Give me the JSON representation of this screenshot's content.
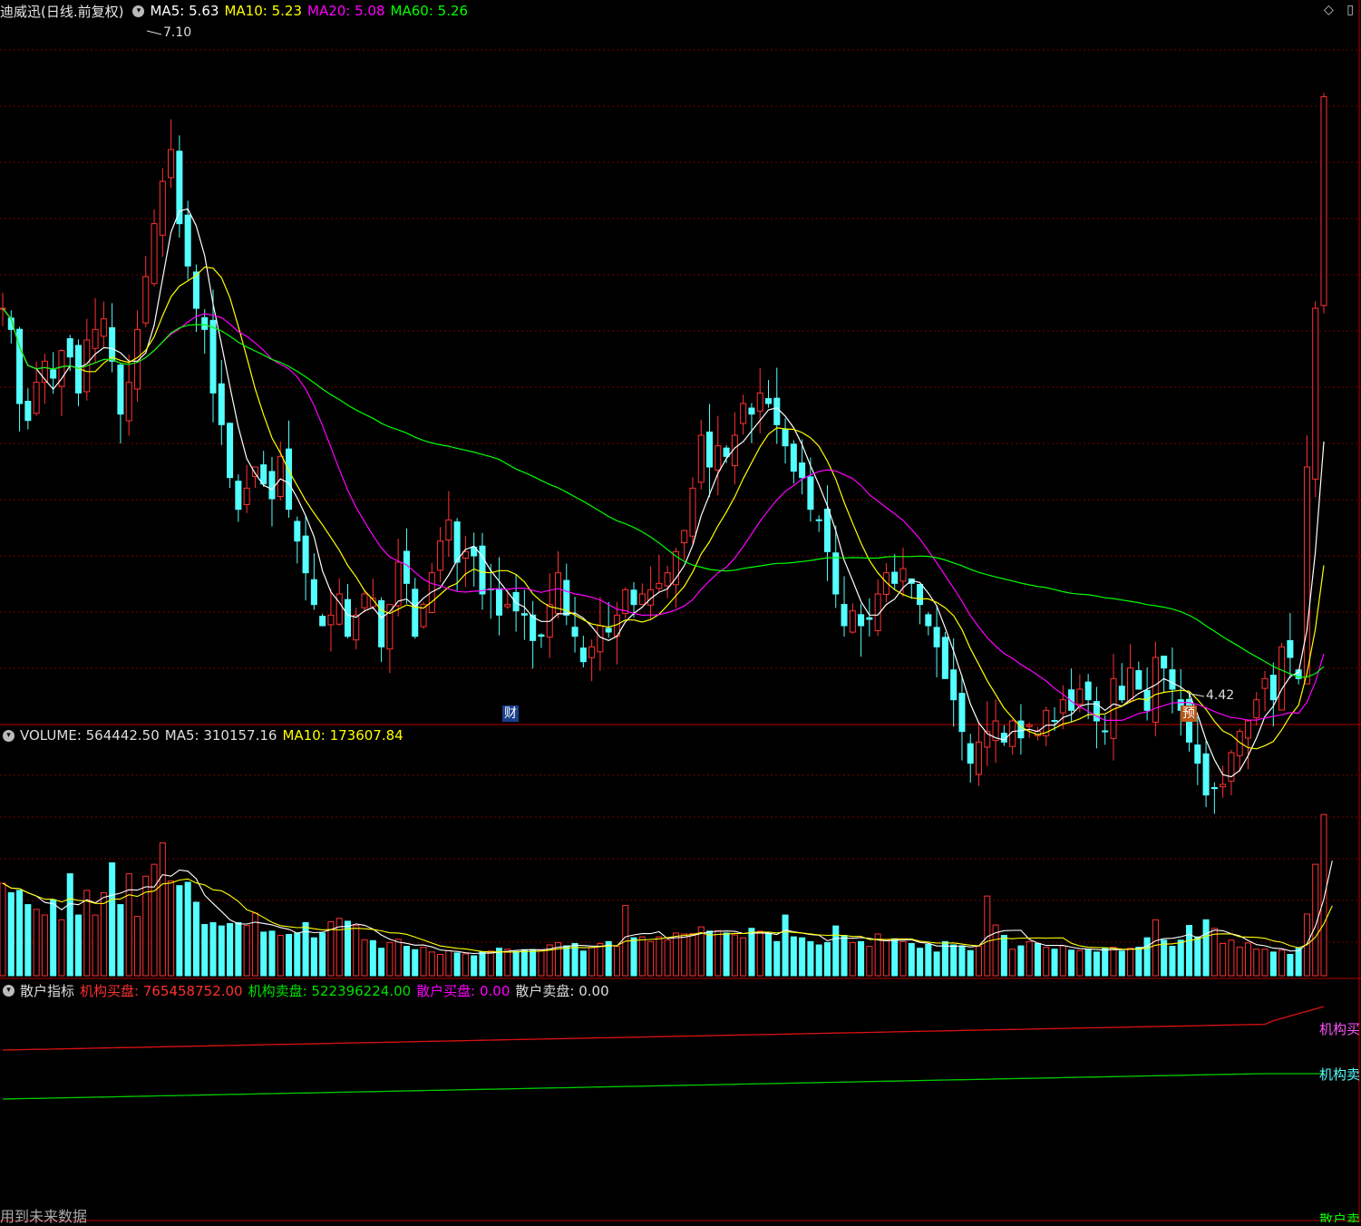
{
  "price_panel": {
    "title": "迪威迅(日线.前复权)",
    "ma": [
      {
        "label": "MA5: ",
        "value": "5.63",
        "color": "#ffffff"
      },
      {
        "label": "MA10: ",
        "value": "5.23",
        "color": "#ffff00"
      },
      {
        "label": "MA20: ",
        "value": "5.08",
        "color": "#ff00ff"
      },
      {
        "label": "MA60: ",
        "value": "5.26",
        "color": "#00ff00"
      }
    ],
    "high_label": "7.10",
    "low_label": "4.42",
    "badge_cai": "财",
    "badge_yu": "预"
  },
  "volume_panel": {
    "name": "VOLUME: ",
    "value": "564442.50",
    "ma5_label": "MA5: ",
    "ma5_value": "310157.16",
    "ma10_label": "MA10: ",
    "ma10_value": "173607.84"
  },
  "indicator_panel": {
    "name": "散户指标",
    "items": [
      {
        "label": "机构买盘: ",
        "value": "765458752.00",
        "color": "#ff3030"
      },
      {
        "label": "机构卖盘: ",
        "value": "522396224.00",
        "color": "#00e000"
      },
      {
        "label": "散户买盘: ",
        "value": "0.00",
        "color": "#ff00ff"
      },
      {
        "label": "散户卖盘: ",
        "value": "0.00",
        "color": "#dddddd"
      }
    ],
    "right_label_1": "机构买",
    "right_label_2": "机构卖",
    "right_label_3": "散户卖"
  },
  "footer_text": "用到未来数据",
  "colors": {
    "up": "#ff3232",
    "down": "#54ffff",
    "grid": "#7a0000",
    "border": "#b00000"
  },
  "chart_data": {
    "type": "candlestick",
    "ylim": [
      4.0,
      7.3
    ],
    "closes": [
      5.95,
      5.85,
      5.5,
      5.42,
      5.6,
      5.7,
      5.62,
      5.75,
      5.72,
      5.55,
      5.8,
      5.85,
      5.9,
      5.7,
      5.45,
      5.6,
      5.85,
      6.1,
      6.35,
      6.55,
      6.7,
      6.35,
      6.15,
      5.95,
      5.85,
      5.55,
      5.4,
      5.15,
      5.0,
      5.1,
      5.2,
      5.12,
      5.05,
      5.25,
      5.0,
      4.85,
      4.7,
      4.55,
      4.45,
      4.5,
      4.6,
      4.4,
      4.5,
      4.6,
      4.58,
      4.35,
      4.55,
      4.75,
      4.65,
      4.4,
      4.55,
      4.7,
      4.85,
      4.95,
      4.75,
      4.8,
      4.78,
      4.6,
      4.62,
      4.5,
      4.55,
      4.52,
      4.5,
      4.38,
      4.4,
      4.55,
      4.7,
      4.5,
      4.4,
      4.28,
      4.35,
      4.45,
      4.42,
      4.5,
      4.62,
      4.55,
      4.6,
      4.62,
      4.65,
      4.7,
      4.8,
      4.9,
      5.1,
      5.35,
      5.2,
      5.3,
      5.25,
      5.35,
      5.5,
      5.45,
      5.55,
      5.5,
      5.4,
      5.3,
      5.18,
      5.15,
      5.0,
      4.95,
      4.8,
      4.6,
      4.45,
      4.52,
      4.45,
      4.48,
      4.6,
      4.7,
      4.65,
      4.72,
      4.65,
      4.55,
      4.45,
      4.35,
      4.2,
      4.1,
      3.95,
      3.8,
      3.9,
      3.95,
      4.0,
      3.9,
      4.0,
      3.92,
      3.98,
      3.95,
      4.05,
      4.0,
      4.1,
      4.05,
      4.15,
      4.1,
      4.0,
      3.95,
      4.2,
      4.1,
      4.25,
      4.15,
      4.05,
      4.3,
      4.25,
      4.15,
      4.05,
      3.9,
      3.8,
      3.65,
      3.68,
      3.7,
      3.85,
      3.95,
      4.0,
      4.1,
      4.2,
      4.1,
      4.35,
      4.3,
      4.2,
      5.2,
      5.95,
      6.95
    ],
    "volumes": [
      195000,
      175000,
      180000,
      150000,
      140000,
      128000,
      160000,
      118000,
      215000,
      128000,
      180000,
      128000,
      175000,
      238000,
      150000,
      215000,
      125000,
      210000,
      235000,
      280000,
      200000,
      190000,
      197000,
      155000,
      108000,
      112000,
      105000,
      110000,
      112000,
      106000,
      132000,
      92000,
      94000,
      85000,
      87000,
      90000,
      112000,
      80000,
      90000,
      114000,
      121000,
      115000,
      106000,
      76000,
      74000,
      58000,
      70000,
      77000,
      62000,
      55000,
      60000,
      50000,
      45000,
      53000,
      48000,
      46000,
      42000,
      50000,
      52000,
      58000,
      56000,
      51000,
      55000,
      55000,
      55000,
      65000,
      70000,
      63000,
      68000,
      52000,
      60000,
      68000,
      72000,
      62000,
      148000,
      80000,
      82000,
      72000,
      82000,
      75000,
      90000,
      88000,
      89000,
      103000,
      94000,
      95000,
      90000,
      86000,
      80000,
      100000,
      94000,
      88000,
      72000,
      128000,
      82000,
      80000,
      72000,
      65000,
      70000,
      105000,
      85000,
      70000,
      72000,
      62000,
      88000,
      75000,
      78000,
      72000,
      68000,
      58000,
      66000,
      50000,
      72000,
      65000,
      63000,
      53000,
      62000,
      168000,
      107000,
      85000,
      56000,
      63000,
      72000,
      68000,
      60000,
      56000,
      63000,
      54000,
      53000,
      55000,
      50000,
      58000,
      60000,
      52000,
      58000,
      60000,
      80000,
      118000,
      75000,
      62000,
      75000,
      106000,
      82000,
      118000,
      100000,
      68000,
      75000,
      60000,
      69000,
      56000,
      56000,
      50000,
      54000,
      45000,
      58000,
      130000,
      235000,
      340000,
      450000
    ],
    "vol_ylim": [
      0,
      480000
    ],
    "ind_buy": [
      710000000.0,
      765500000.0
    ],
    "ind_sell": [
      500000000.0,
      522400000.0
    ]
  }
}
